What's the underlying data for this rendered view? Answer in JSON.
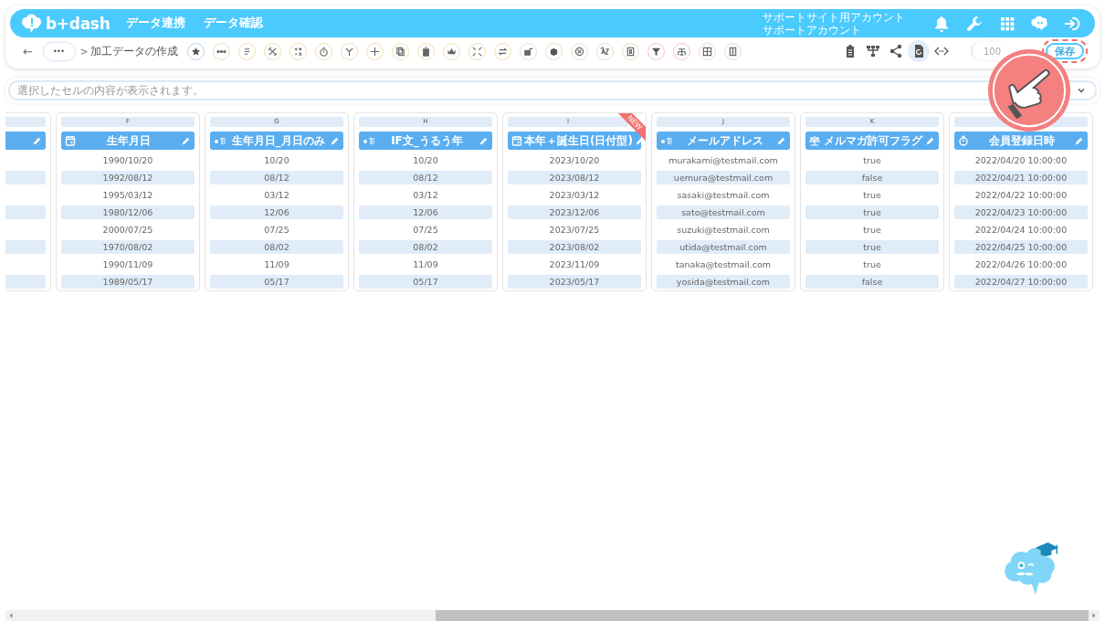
{
  "header": {
    "logo": "b+dash",
    "nav": [
      {
        "label": "データ連携"
      },
      {
        "label": "データ確認"
      }
    ],
    "account": [
      "サポートサイト用アカウント",
      "サポートアカウント"
    ]
  },
  "toolbar": {
    "back": "←",
    "more": "•••",
    "separator": ">",
    "breadcrumb": "加工データの作成",
    "tools": [
      {
        "color": "#b9d3ee"
      },
      {
        "color": "#f3dfb3"
      },
      {
        "color": "#f3dfb3"
      },
      {
        "color": "#f3dfb3"
      },
      {
        "color": "#f3dfb3"
      },
      {
        "color": "#f3dfb3"
      },
      {
        "color": "#f3dfb3"
      },
      {
        "color": "#f3dfb3"
      },
      {
        "color": "#f3dfb3"
      },
      {
        "color": "#f3dfb3"
      },
      {
        "color": "#f3dfb3"
      },
      {
        "color": "#f3dfb3"
      },
      {
        "color": "#f3dfb3"
      },
      {
        "color": "#dde6c8"
      },
      {
        "color": "#dde6c8"
      },
      {
        "color": "#dde6c8"
      },
      {
        "color": "#dde6c8"
      },
      {
        "color": "#dde6c8"
      },
      {
        "color": "#f6c4c4"
      },
      {
        "color": "#f6c4c4"
      },
      {
        "color": "#ecd2f3"
      },
      {
        "color": "#ecd2f3"
      }
    ],
    "view_buttons": [
      {
        "selected": false
      },
      {
        "selected": false
      },
      {
        "selected": false
      },
      {
        "selected": true
      },
      {
        "selected": false
      }
    ],
    "zoom": "100",
    "save": "保存",
    "save_highlighted": true
  },
  "formula_bar": {
    "placeholder": "選択したセルの内容が表示されます。"
  },
  "table": {
    "columns": [
      {
        "cut": true
      },
      {
        "cut": false,
        "letter": "F",
        "kind": "date",
        "title": "生年月日",
        "cells": [
          "1990/10/20",
          "1992/08/12",
          "1995/03/12",
          "1980/12/06",
          "2000/07/25",
          "1970/08/02",
          "1990/11/09",
          "1989/05/17"
        ]
      },
      {
        "cut": false,
        "letter": "G",
        "kind": "text",
        "title": "生年月日_月日のみ",
        "cells": [
          "10/20",
          "08/12",
          "03/12",
          "12/06",
          "07/25",
          "08/02",
          "11/09",
          "05/17"
        ]
      },
      {
        "cut": false,
        "letter": "H",
        "kind": "text",
        "title": "IF文_うるう年",
        "cells": [
          "10/20",
          "08/12",
          "03/12",
          "12/06",
          "07/25",
          "08/02",
          "11/09",
          "05/17"
        ]
      },
      {
        "cut": false,
        "letter": "I",
        "kind": "date",
        "title": "本年＋誕生日(日付型)",
        "badge": "NEW",
        "cells": [
          "2023/10/20",
          "2023/08/12",
          "2023/03/12",
          "2023/12/06",
          "2023/07/25",
          "2023/08/02",
          "2023/11/09",
          "2023/05/17"
        ]
      },
      {
        "cut": false,
        "letter": "J",
        "kind": "text",
        "title": "メールアドレス",
        "cells": [
          "murakami@testmail.com",
          "uemura@testmail.com",
          "sasaki@testmail.com",
          "sato@testmail.com",
          "suzuki@testmail.com",
          "utida@testmail.com",
          "tanaka@testmail.com",
          "yosida@testmail.com"
        ]
      },
      {
        "cut": false,
        "letter": "K",
        "kind": "flag",
        "title": "メルマガ許可フラグ",
        "cells": [
          "true",
          "false",
          "true",
          "true",
          "true",
          "true",
          "true",
          "false"
        ]
      },
      {
        "cut": false,
        "kind": "datetime",
        "title": "会員登録日時",
        "cells": [
          "2022/04/20 10:00:00",
          "2022/04/21 10:00:00",
          "2022/04/22 10:00:00",
          "2022/04/23 10:00:00",
          "2022/04/24 10:00:00",
          "2022/04/25 10:00:00",
          "2022/04/26 10:00:00",
          "2022/04/27 10:00:00"
        ]
      }
    ]
  }
}
